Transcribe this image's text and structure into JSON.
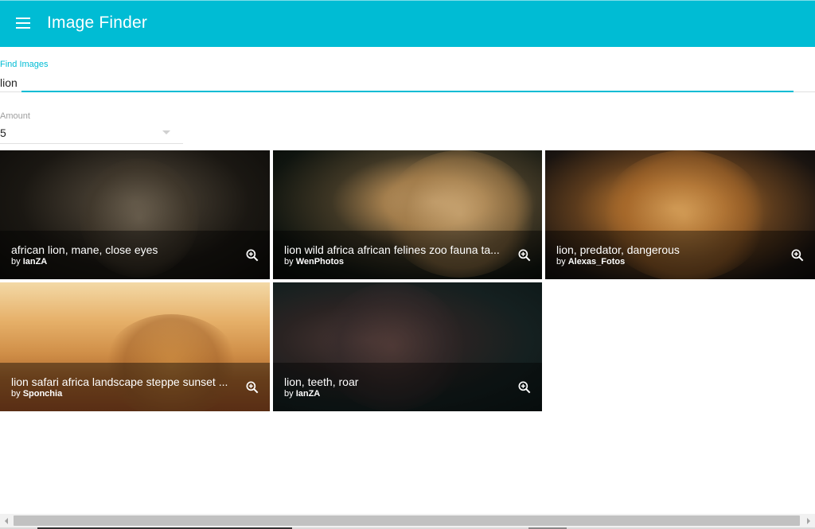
{
  "app": {
    "title": "Image Finder",
    "menu_icon": "hamburger-menu-icon",
    "accent": "#00bcd4"
  },
  "search": {
    "label": "Find Images",
    "value": "lion"
  },
  "amount": {
    "label": "Amount",
    "value": "5"
  },
  "results": [
    {
      "title": "african lion, mane, close eyes",
      "by": "by",
      "author": "IanZA"
    },
    {
      "title": "lion wild africa african felines zoo fauna ta...",
      "by": "by",
      "author": "WenPhotos"
    },
    {
      "title": "lion, predator, dangerous",
      "by": "by",
      "author": "Alexas_Fotos"
    },
    {
      "title": "lion safari africa landscape steppe sunset ...",
      "by": "by",
      "author": "Sponchia"
    },
    {
      "title": "lion, teeth, roar",
      "by": "by",
      "author": "IanZA"
    }
  ],
  "icons": {
    "zoom": "zoom-in-icon"
  }
}
